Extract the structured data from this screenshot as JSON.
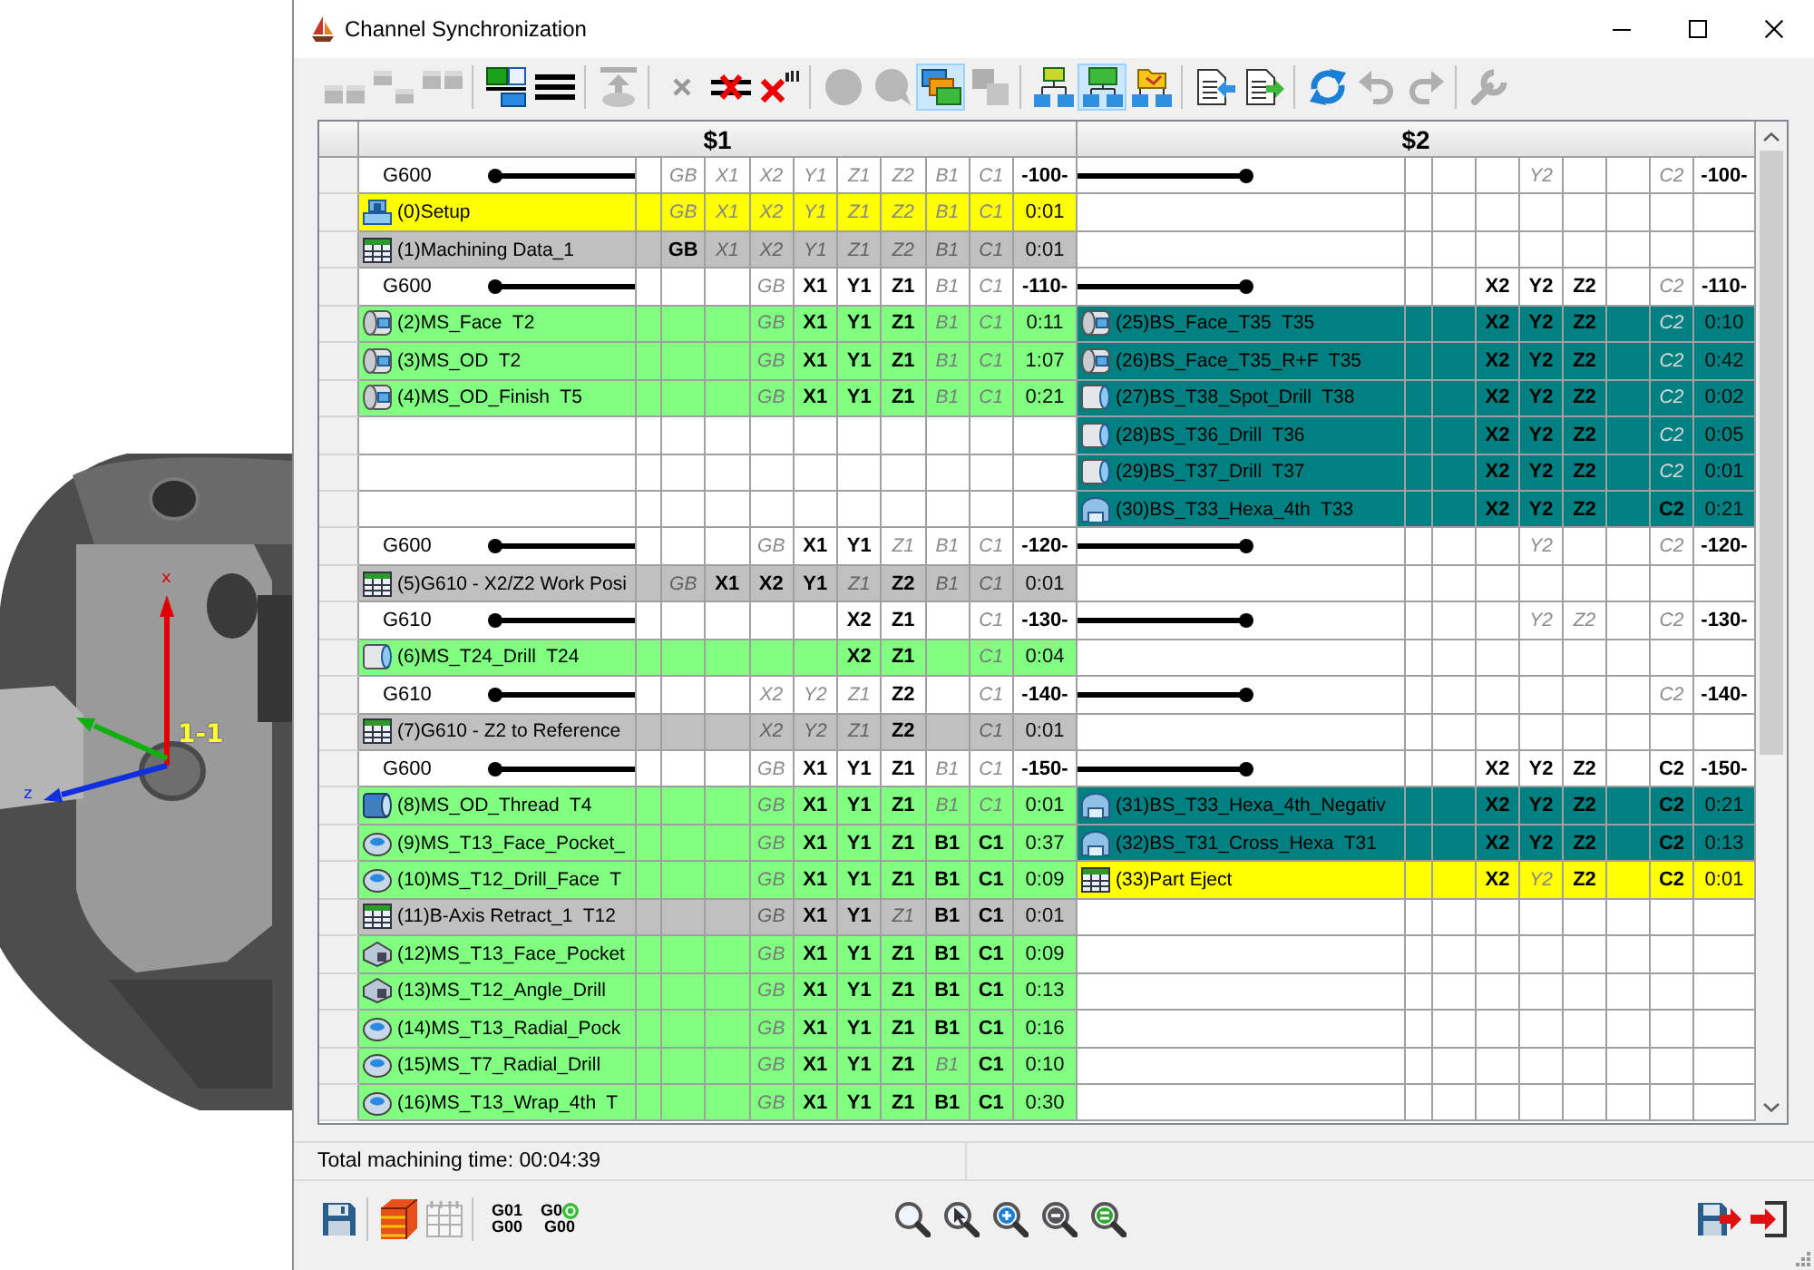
{
  "viewport": {
    "origin_label": "1-1",
    "axis_labels": [
      "x",
      "z"
    ]
  },
  "window": {
    "title": "Channel Synchronization"
  },
  "toolbar": [
    [
      {
        "selected": false,
        "disabled": true
      },
      {
        "selected": false,
        "disabled": true
      },
      {
        "selected": false,
        "disabled": true
      }
    ],
    [
      {
        "selected": false,
        "disabled": false
      },
      {
        "selected": false,
        "disabled": false
      }
    ],
    [
      {
        "selected": false,
        "disabled": true
      }
    ],
    [
      {
        "selected": false,
        "disabled": true
      },
      {
        "selected": false,
        "disabled": false
      },
      {
        "selected": false,
        "disabled": false
      }
    ],
    [
      {
        "selected": false,
        "disabled": true
      },
      {
        "selected": false,
        "disabled": true
      },
      {
        "selected": true,
        "disabled": false
      },
      {
        "selected": false,
        "disabled": true
      }
    ],
    [
      {
        "selected": false,
        "disabled": false
      },
      {
        "selected": true,
        "disabled": false
      },
      {
        "selected": false,
        "disabled": false
      }
    ],
    [
      {
        "selected": false,
        "disabled": false
      },
      {
        "selected": false,
        "disabled": false
      }
    ],
    [
      {
        "selected": false,
        "disabled": false
      },
      {
        "selected": false,
        "disabled": true
      },
      {
        "selected": false,
        "disabled": true
      }
    ],
    [
      {
        "selected": false,
        "disabled": true
      }
    ]
  ],
  "grid": {
    "headers": [
      "$1",
      "$2"
    ],
    "rows": [
      {
        "left": {
          "kind": "sync",
          "code": "G600",
          "cells": [
            {
              "text": "GB",
              "active": false
            },
            {
              "text": "X1",
              "active": false
            },
            {
              "text": "X2",
              "active": false
            },
            {
              "text": "Y1",
              "active": false
            },
            {
              "text": "Z1",
              "active": false
            },
            {
              "text": "Z2",
              "active": false
            },
            {
              "text": "B1",
              "active": false
            },
            {
              "text": "C1",
              "active": false
            }
          ],
          "time": "-100-"
        },
        "right": {
          "kind": "sync",
          "cells": [
            null,
            null,
            {
              "text": "Y2",
              "active": false
            },
            null,
            null,
            {
              "text": "C2",
              "active": false
            }
          ],
          "time": "-100-"
        }
      },
      {
        "left": {
          "kind": "setup",
          "color": "#ffff00",
          "name": "(0)Setup",
          "cells": [
            {
              "text": "GB",
              "active": false
            },
            {
              "text": "X1",
              "active": false
            },
            {
              "text": "X2",
              "active": false
            },
            {
              "text": "Y1",
              "active": false
            },
            {
              "text": "Z1",
              "active": false
            },
            {
              "text": "Z2",
              "active": false
            },
            {
              "text": "B1",
              "active": false
            },
            {
              "text": "C1",
              "active": false
            }
          ],
          "time": "0:01"
        },
        "right": {
          "kind": "empty"
        }
      },
      {
        "left": {
          "kind": "data",
          "color": "#c0c0c0",
          "name": "(1)Machining Data_1",
          "cells": [
            {
              "text": "GB",
              "active": true
            },
            {
              "text": "X1",
              "active": false
            },
            {
              "text": "X2",
              "active": false
            },
            {
              "text": "Y1",
              "active": false
            },
            {
              "text": "Z1",
              "active": false
            },
            {
              "text": "Z2",
              "active": false
            },
            {
              "text": "B1",
              "active": false
            },
            {
              "text": "C1",
              "active": false
            }
          ],
          "time": "0:01"
        },
        "right": {
          "kind": "empty"
        }
      },
      {
        "left": {
          "kind": "sync",
          "code": "G600",
          "cells": [
            null,
            null,
            {
              "text": "GB",
              "active": false
            },
            {
              "text": "X1",
              "active": true
            },
            {
              "text": "Y1",
              "active": true
            },
            {
              "text": "Z1",
              "active": true
            },
            {
              "text": "B1",
              "active": false
            },
            {
              "text": "C1",
              "active": false
            }
          ],
          "time": "-110-"
        },
        "right": {
          "kind": "sync",
          "cells": [
            null,
            {
              "text": "X2",
              "active": true
            },
            {
              "text": "Y2",
              "active": true
            },
            {
              "text": "Z2",
              "active": true
            },
            null,
            {
              "text": "C2",
              "active": false
            }
          ],
          "time": "-110-"
        }
      },
      {
        "left": {
          "kind": "turning",
          "color": "#80ff80",
          "name": "(2)MS_Face  T2",
          "cells": [
            null,
            null,
            {
              "text": "GB",
              "active": false
            },
            {
              "text": "X1",
              "active": true
            },
            {
              "text": "Y1",
              "active": true
            },
            {
              "text": "Z1",
              "active": true
            },
            {
              "text": "B1",
              "active": false
            },
            {
              "text": "C1",
              "active": false
            }
          ],
          "time": "0:11"
        },
        "right": {
          "kind": "turning",
          "color": "#008080",
          "name": "(25)BS_Face_T35  T35",
          "cells": [
            null,
            {
              "text": "X2",
              "active": true
            },
            {
              "text": "Y2",
              "active": true
            },
            {
              "text": "Z2",
              "active": true
            },
            null,
            {
              "text": "C2",
              "active": false
            }
          ],
          "time": "0:10"
        }
      },
      {
        "left": {
          "kind": "turning",
          "color": "#80ff80",
          "name": "(3)MS_OD  T2",
          "cells": [
            null,
            null,
            {
              "text": "GB",
              "active": false
            },
            {
              "text": "X1",
              "active": true
            },
            {
              "text": "Y1",
              "active": true
            },
            {
              "text": "Z1",
              "active": true
            },
            {
              "text": "B1",
              "active": false
            },
            {
              "text": "C1",
              "active": false
            }
          ],
          "time": "1:07"
        },
        "right": {
          "kind": "turning",
          "color": "#008080",
          "name": "(26)BS_Face_T35_R+F  T35",
          "cells": [
            null,
            {
              "text": "X2",
              "active": true
            },
            {
              "text": "Y2",
              "active": true
            },
            {
              "text": "Z2",
              "active": true
            },
            null,
            {
              "text": "C2",
              "active": false
            }
          ],
          "time": "0:42"
        }
      },
      {
        "left": {
          "kind": "turning",
          "color": "#80ff80",
          "name": "(4)MS_OD_Finish  T5",
          "cells": [
            null,
            null,
            {
              "text": "GB",
              "active": false
            },
            {
              "text": "X1",
              "active": true
            },
            {
              "text": "Y1",
              "active": true
            },
            {
              "text": "Z1",
              "active": true
            },
            {
              "text": "B1",
              "active": false
            },
            {
              "text": "C1",
              "active": false
            }
          ],
          "time": "0:21"
        },
        "right": {
          "kind": "drill",
          "color": "#008080",
          "name": "(27)BS_T38_Spot_Drill  T38",
          "cells": [
            null,
            {
              "text": "X2",
              "active": true
            },
            {
              "text": "Y2",
              "active": true
            },
            {
              "text": "Z2",
              "active": true
            },
            null,
            {
              "text": "C2",
              "active": false
            }
          ],
          "time": "0:02"
        }
      },
      {
        "left": {
          "kind": "empty"
        },
        "right": {
          "kind": "drill",
          "color": "#008080",
          "name": "(28)BS_T36_Drill  T36",
          "cells": [
            null,
            {
              "text": "X2",
              "active": true
            },
            {
              "text": "Y2",
              "active": true
            },
            {
              "text": "Z2",
              "active": true
            },
            null,
            {
              "text": "C2",
              "active": false
            }
          ],
          "time": "0:05"
        }
      },
      {
        "left": {
          "kind": "empty"
        },
        "right": {
          "kind": "drill",
          "color": "#008080",
          "name": "(29)BS_T37_Drill  T37",
          "cells": [
            null,
            {
              "text": "X2",
              "active": true
            },
            {
              "text": "Y2",
              "active": true
            },
            {
              "text": "Z2",
              "active": true
            },
            null,
            {
              "text": "C2",
              "active": false
            }
          ],
          "time": "0:01"
        }
      },
      {
        "left": {
          "kind": "empty"
        },
        "right": {
          "kind": "hexa",
          "color": "#008080",
          "name": "(30)BS_T33_Hexa_4th  T33",
          "cells": [
            null,
            {
              "text": "X2",
              "active": true
            },
            {
              "text": "Y2",
              "active": true
            },
            {
              "text": "Z2",
              "active": true
            },
            null,
            {
              "text": "C2",
              "active": true
            }
          ],
          "time": "0:21"
        }
      },
      {
        "left": {
          "kind": "sync",
          "code": "G600",
          "cells": [
            null,
            null,
            {
              "text": "GB",
              "active": false
            },
            {
              "text": "X1",
              "active": true
            },
            {
              "text": "Y1",
              "active": true
            },
            {
              "text": "Z1",
              "active": false
            },
            {
              "text": "B1",
              "active": false
            },
            {
              "text": "C1",
              "active": false
            }
          ],
          "time": "-120-"
        },
        "right": {
          "kind": "sync",
          "cells": [
            null,
            null,
            {
              "text": "Y2",
              "active": false
            },
            null,
            null,
            {
              "text": "C2",
              "active": false
            }
          ],
          "time": "-120-"
        }
      },
      {
        "left": {
          "kind": "data",
          "color": "#c0c0c0",
          "name": "(5)G610 - X2/Z2 Work Posi",
          "cells": [
            {
              "text": "GB",
              "active": false
            },
            {
              "text": "X1",
              "active": true
            },
            {
              "text": "X2",
              "active": true
            },
            {
              "text": "Y1",
              "active": true
            },
            {
              "text": "Z1",
              "active": false
            },
            {
              "text": "Z2",
              "active": true
            },
            {
              "text": "B1",
              "active": false
            },
            {
              "text": "C1",
              "active": false
            }
          ],
          "time": "0:01"
        },
        "right": {
          "kind": "empty"
        }
      },
      {
        "left": {
          "kind": "sync",
          "code": "G610",
          "cells": [
            null,
            null,
            null,
            null,
            {
              "text": "X2",
              "active": true
            },
            {
              "text": "Z1",
              "active": true
            },
            null,
            {
              "text": "C1",
              "active": false
            }
          ],
          "time": "-130-"
        },
        "right": {
          "kind": "sync",
          "cells": [
            null,
            null,
            {
              "text": "Y2",
              "active": false
            },
            {
              "text": "Z2",
              "active": false
            },
            null,
            {
              "text": "C2",
              "active": false
            }
          ],
          "time": "-130-"
        }
      },
      {
        "left": {
          "kind": "drill",
          "color": "#80ff80",
          "name": "(6)MS_T24_Drill  T24",
          "cells": [
            null,
            null,
            null,
            null,
            {
              "text": "X2",
              "active": true
            },
            {
              "text": "Z1",
              "active": true
            },
            null,
            {
              "text": "C1",
              "active": false
            }
          ],
          "time": "0:04"
        },
        "right": {
          "kind": "empty"
        }
      },
      {
        "left": {
          "kind": "sync",
          "code": "G610",
          "cells": [
            null,
            null,
            {
              "text": "X2",
              "active": false
            },
            {
              "text": "Y2",
              "active": false
            },
            {
              "text": "Z1",
              "active": false
            },
            {
              "text": "Z2",
              "active": true
            },
            null,
            {
              "text": "C1",
              "active": false
            }
          ],
          "time": "-140-"
        },
        "right": {
          "kind": "sync",
          "cells": [
            null,
            null,
            null,
            null,
            null,
            {
              "text": "C2",
              "active": false
            }
          ],
          "time": "-140-"
        }
      },
      {
        "left": {
          "kind": "data",
          "color": "#c0c0c0",
          "name": "(7)G610 - Z2 to Reference",
          "cells": [
            null,
            null,
            {
              "text": "X2",
              "active": false
            },
            {
              "text": "Y2",
              "active": false
            },
            {
              "text": "Z1",
              "active": false
            },
            {
              "text": "Z2",
              "active": true
            },
            null,
            {
              "text": "C1",
              "active": false
            }
          ],
          "time": "0:01"
        },
        "right": {
          "kind": "empty"
        }
      },
      {
        "left": {
          "kind": "sync",
          "code": "G600",
          "cells": [
            null,
            null,
            {
              "text": "GB",
              "active": false
            },
            {
              "text": "X1",
              "active": true
            },
            {
              "text": "Y1",
              "active": true
            },
            {
              "text": "Z1",
              "active": true
            },
            {
              "text": "B1",
              "active": false
            },
            {
              "text": "C1",
              "active": false
            }
          ],
          "time": "-150-"
        },
        "right": {
          "kind": "sync",
          "cells": [
            null,
            {
              "text": "X2",
              "active": true
            },
            {
              "text": "Y2",
              "active": true
            },
            {
              "text": "Z2",
              "active": true
            },
            null,
            {
              "text": "C2",
              "active": true
            }
          ],
          "time": "-150-"
        }
      },
      {
        "left": {
          "kind": "thread",
          "color": "#80ff80",
          "name": "(8)MS_OD_Thread  T4",
          "cells": [
            null,
            null,
            {
              "text": "GB",
              "active": false
            },
            {
              "text": "X1",
              "active": true
            },
            {
              "text": "Y1",
              "active": true
            },
            {
              "text": "Z1",
              "active": true
            },
            {
              "text": "B1",
              "active": false
            },
            {
              "text": "C1",
              "active": false
            }
          ],
          "time": "0:01"
        },
        "right": {
          "kind": "hexa",
          "color": "#008080",
          "name": "(31)BS_T33_Hexa_4th_Negativ",
          "cells": [
            null,
            {
              "text": "X2",
              "active": true
            },
            {
              "text": "Y2",
              "active": true
            },
            {
              "text": "Z2",
              "active": true
            },
            null,
            {
              "text": "C2",
              "active": true
            }
          ],
          "time": "0:21"
        }
      },
      {
        "left": {
          "kind": "milling",
          "color": "#80ff80",
          "name": "(9)MS_T13_Face_Pocket_",
          "cells": [
            null,
            null,
            {
              "text": "GB",
              "active": false
            },
            {
              "text": "X1",
              "active": true
            },
            {
              "text": "Y1",
              "active": true
            },
            {
              "text": "Z1",
              "active": true
            },
            {
              "text": "B1",
              "active": true
            },
            {
              "text": "C1",
              "active": true
            }
          ],
          "time": "0:37"
        },
        "right": {
          "kind": "hexa",
          "color": "#008080",
          "name": "(32)BS_T31_Cross_Hexa  T31",
          "cells": [
            null,
            {
              "text": "X2",
              "active": true
            },
            {
              "text": "Y2",
              "active": true
            },
            {
              "text": "Z2",
              "active": true
            },
            null,
            {
              "text": "C2",
              "active": true
            }
          ],
          "time": "0:13"
        }
      },
      {
        "left": {
          "kind": "milling",
          "color": "#80ff80",
          "name": "(10)MS_T12_Drill_Face  T",
          "cells": [
            null,
            null,
            {
              "text": "GB",
              "active": false
            },
            {
              "text": "X1",
              "active": true
            },
            {
              "text": "Y1",
              "active": true
            },
            {
              "text": "Z1",
              "active": true
            },
            {
              "text": "B1",
              "active": true
            },
            {
              "text": "C1",
              "active": true
            }
          ],
          "time": "0:09"
        },
        "right": {
          "kind": "data",
          "color": "#ffff00",
          "name": "(33)Part Eject",
          "cells": [
            null,
            {
              "text": "X2",
              "active": true
            },
            {
              "text": "Y2",
              "active": false
            },
            {
              "text": "Z2",
              "active": true
            },
            null,
            {
              "text": "C2",
              "active": true
            }
          ],
          "time": "0:01"
        }
      },
      {
        "left": {
          "kind": "data",
          "color": "#c0c0c0",
          "name": "(11)B-Axis Retract_1  T12",
          "cells": [
            null,
            null,
            {
              "text": "GB",
              "active": false
            },
            {
              "text": "X1",
              "active": true
            },
            {
              "text": "Y1",
              "active": true
            },
            {
              "text": "Z1",
              "active": false
            },
            {
              "text": "B1",
              "active": true
            },
            {
              "text": "C1",
              "active": true
            }
          ],
          "time": "0:01"
        },
        "right": {
          "kind": "empty"
        }
      },
      {
        "left": {
          "kind": "angle",
          "color": "#80ff80",
          "name": "(12)MS_T13_Face_Pocket",
          "cells": [
            null,
            null,
            {
              "text": "GB",
              "active": false
            },
            {
              "text": "X1",
              "active": true
            },
            {
              "text": "Y1",
              "active": true
            },
            {
              "text": "Z1",
              "active": true
            },
            {
              "text": "B1",
              "active": true
            },
            {
              "text": "C1",
              "active": true
            }
          ],
          "time": "0:09"
        },
        "right": {
          "kind": "empty"
        }
      },
      {
        "left": {
          "kind": "angle",
          "color": "#80ff80",
          "name": "(13)MS_T12_Angle_Drill",
          "cells": [
            null,
            null,
            {
              "text": "GB",
              "active": false
            },
            {
              "text": "X1",
              "active": true
            },
            {
              "text": "Y1",
              "active": true
            },
            {
              "text": "Z1",
              "active": true
            },
            {
              "text": "B1",
              "active": true
            },
            {
              "text": "C1",
              "active": true
            }
          ],
          "time": "0:13"
        },
        "right": {
          "kind": "empty"
        }
      },
      {
        "left": {
          "kind": "milling",
          "color": "#80ff80",
          "name": "(14)MS_T13_Radial_Pock",
          "cells": [
            null,
            null,
            {
              "text": "GB",
              "active": false
            },
            {
              "text": "X1",
              "active": true
            },
            {
              "text": "Y1",
              "active": true
            },
            {
              "text": "Z1",
              "active": true
            },
            {
              "text": "B1",
              "active": true
            },
            {
              "text": "C1",
              "active": true
            }
          ],
          "time": "0:16"
        },
        "right": {
          "kind": "empty"
        }
      },
      {
        "left": {
          "kind": "milling",
          "color": "#80ff80",
          "name": "(15)MS_T7_Radial_Drill",
          "cells": [
            null,
            null,
            {
              "text": "GB",
              "active": false
            },
            {
              "text": "X1",
              "active": true
            },
            {
              "text": "Y1",
              "active": true
            },
            {
              "text": "Z1",
              "active": true
            },
            {
              "text": "B1",
              "active": false
            },
            {
              "text": "C1",
              "active": true
            }
          ],
          "time": "0:10"
        },
        "right": {
          "kind": "empty"
        }
      },
      {
        "left": {
          "kind": "milling",
          "color": "#80ff80",
          "name": "(16)MS_T13_Wrap_4th  T",
          "cells": [
            null,
            null,
            {
              "text": "GB",
              "active": false
            },
            {
              "text": "X1",
              "active": true
            },
            {
              "text": "Y1",
              "active": true
            },
            {
              "text": "Z1",
              "active": true
            },
            {
              "text": "B1",
              "active": true
            },
            {
              "text": "C1",
              "active": true
            }
          ],
          "time": "0:30"
        },
        "right": {
          "kind": "empty"
        }
      }
    ]
  },
  "status_bar": {
    "text": "Total machining time: 00:04:39"
  },
  "bottom_toolbar": {
    "left": [
      [
        {
          "disabled": false
        }
      ],
      [
        {
          "disabled": false
        },
        {
          "disabled": true
        }
      ],
      [
        {
          "lines": [
            "G01",
            "G00"
          ],
          "disabled": false
        },
        {
          "lines": [
            "G0",
            "G00"
          ],
          "disabled": false
        }
      ]
    ],
    "center": [
      [
        {
          "disabled": false
        },
        {
          "disabled": false
        },
        {
          "disabled": false
        },
        {
          "disabled": false
        },
        {
          "disabled": false
        }
      ]
    ],
    "right": [
      [
        {
          "disabled": false
        },
        {
          "disabled": false
        }
      ]
    ]
  }
}
